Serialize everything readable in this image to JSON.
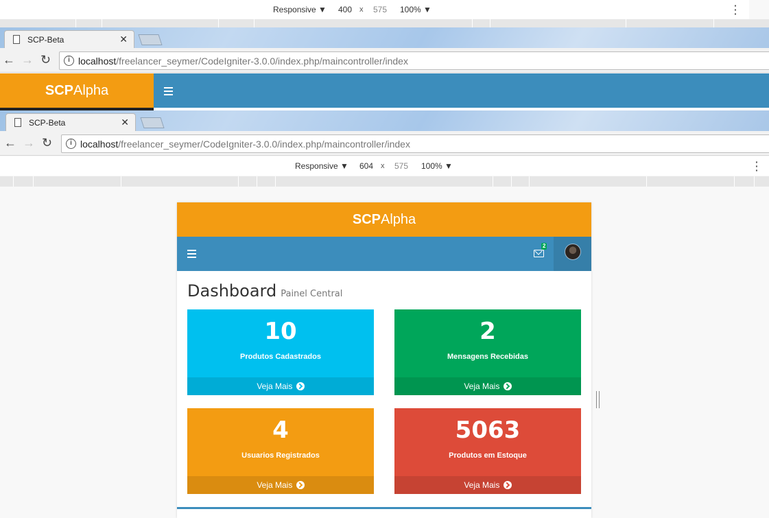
{
  "devtools_top": {
    "preset": "Responsive",
    "width": "400",
    "height": "575",
    "zoom": "100%"
  },
  "devtools_bottom": {
    "preset": "Responsive",
    "width": "604",
    "height": "575",
    "zoom": "100%"
  },
  "browser_top": {
    "tab_title": "SCP-Beta",
    "url_host": "localhost",
    "url_path": "/freelancer_seymer/CodeIgniter-3.0.0/index.php/maincontroller/index"
  },
  "browser_bottom": {
    "tab_title": "SCP-Beta",
    "url_host": "localhost",
    "url_path": "/freelancer_seymer/CodeIgniter-3.0.0/index.php/maincontroller/index"
  },
  "app": {
    "logo_bold": "SCP",
    "logo_light": "Alpha",
    "mail_count": "2",
    "page_title": "Dashboard",
    "page_subtitle": "Painel Central",
    "boxes": [
      {
        "value": "10",
        "label": "Produtos Cadastrados",
        "link": "Veja Mais",
        "color": "#00c0ef"
      },
      {
        "value": "2",
        "label": "Mensagens Recebidas",
        "link": "Veja Mais",
        "color": "#00a65a"
      },
      {
        "value": "4",
        "label": "Usuarios Registrados",
        "link": "Veja Mais",
        "color": "#f39c12"
      },
      {
        "value": "5063",
        "label": "Produtos em Estoque",
        "link": "Veja Mais",
        "color": "#dd4b39"
      }
    ]
  },
  "colors": {
    "brand_orange": "#f39c12",
    "navbar_blue": "#3c8dbc"
  }
}
